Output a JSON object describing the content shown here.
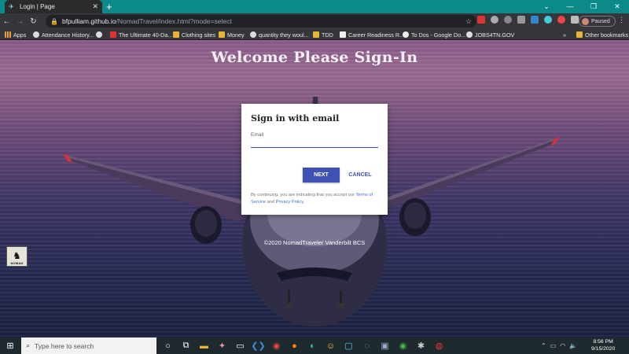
{
  "browser": {
    "tab_title": "Login | Page",
    "tab_favicon": "travel-icon",
    "url_host": "bfpulliam.github.io",
    "url_path": "/NomadTravel/index.html?mode=select",
    "profile_label": "Paused",
    "bookmarks": [
      {
        "label": "Apps",
        "icon": "apps-grid-icon"
      },
      {
        "label": "Attendance History...",
        "icon": "globe-icon"
      },
      {
        "label": "",
        "icon": "globe-icon"
      },
      {
        "label": "The Ultimate 40-Da...",
        "icon": "red-bookmark-icon"
      },
      {
        "label": "Clothing sites",
        "icon": "folder-icon"
      },
      {
        "label": "Money",
        "icon": "folder-icon"
      },
      {
        "label": "quantity they woul...",
        "icon": "globe-icon"
      },
      {
        "label": "TDD",
        "icon": "folder-icon"
      },
      {
        "label": "Career Readiness R...",
        "icon": "doc-icon"
      },
      {
        "label": "To Dos - Google Do...",
        "icon": "google-icon"
      },
      {
        "label": "JOBS4TN.GOV",
        "icon": "globe-icon"
      }
    ],
    "bookmarks_overflow": "»",
    "other_bookmarks": "Other bookmarks"
  },
  "page": {
    "heading": "Welcome Please Sign-In",
    "card_title": "Sign in with email",
    "email_label": "Email",
    "email_value": "",
    "next_label": "NEXT",
    "cancel_label": "CANCEL",
    "terms_prefix": "By continuing, you are indicating that you accept our",
    "terms_link": "Terms of Service",
    "terms_and": "and",
    "privacy_link": "Privacy Policy",
    "terms_suffix": ".",
    "copyright": "©2020 NomadTraveler Vanderbilt BCS",
    "logo_text": "NOMAD"
  },
  "taskbar": {
    "search_placeholder": "Type here to search",
    "time": "8:56 PM",
    "date": "9/15/2020"
  },
  "colors": {
    "accent": "#3f51b5",
    "tab_strip": "#0c8a8a"
  }
}
